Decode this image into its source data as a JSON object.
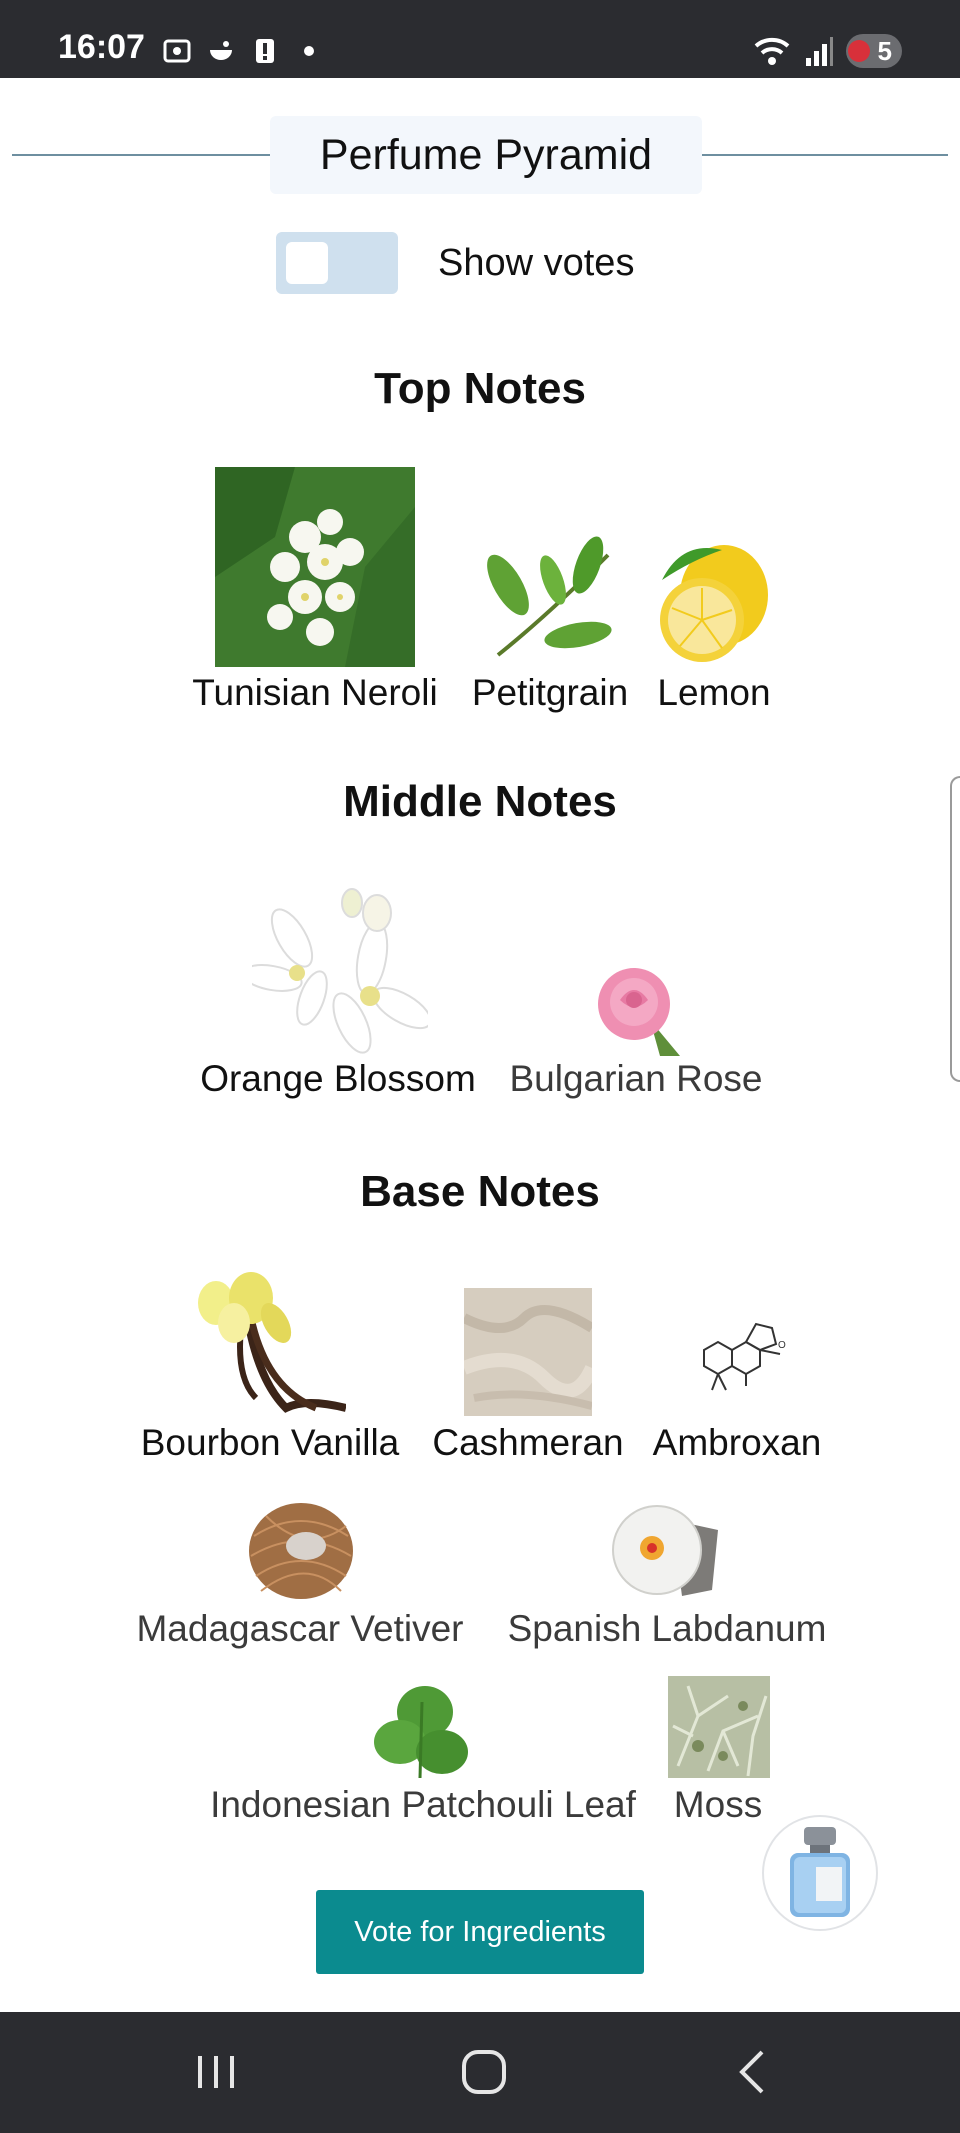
{
  "status": {
    "time": "16:07",
    "battery": "5"
  },
  "header": {
    "title": "Perfume Pyramid"
  },
  "toggle": {
    "label": "Show votes",
    "on": false
  },
  "sections": {
    "top": {
      "title": "Top Notes",
      "notes": [
        "Tunisian Neroli",
        "Petitgrain",
        "Lemon"
      ]
    },
    "middle": {
      "title": "Middle Notes",
      "notes": [
        "Orange Blossom",
        "Bulgarian Rose"
      ]
    },
    "base": {
      "title": "Base Notes",
      "notes": [
        "Bourbon Vanilla",
        "Cashmeran",
        "Ambroxan",
        "Madagascar Vetiver",
        "Spanish Labdanum",
        "Indonesian Patchouli Leaf",
        "Moss"
      ]
    }
  },
  "actions": {
    "vote_label": "Vote for Ingredients"
  },
  "colors": {
    "accent": "#0b8b8f",
    "bars": "#2b2c30",
    "toggle": "#cfe0ee"
  }
}
